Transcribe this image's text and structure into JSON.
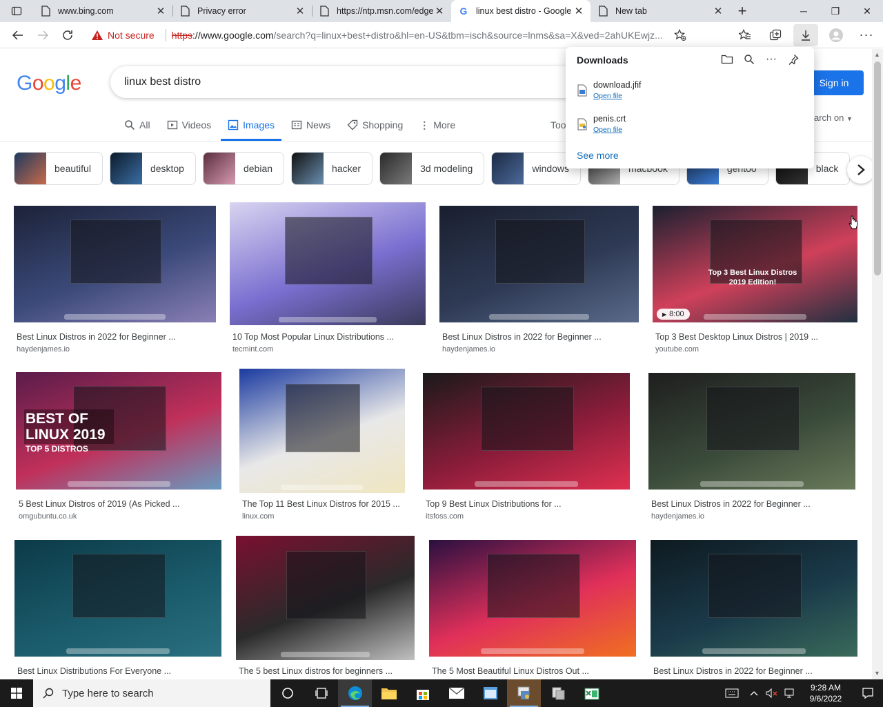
{
  "browser": {
    "tabs": [
      {
        "title": "www.bing.com",
        "icon": "page-icon"
      },
      {
        "title": "Privacy error",
        "icon": "page-icon"
      },
      {
        "title": "https://ntp.msn.com/edge",
        "icon": "page-icon"
      },
      {
        "title": "linux best distro - Google",
        "icon": "google-icon",
        "active": true
      },
      {
        "title": "New tab",
        "icon": "page-icon"
      }
    ],
    "security_label": "Not secure",
    "url": {
      "scheme": "https",
      "host": "://www.google.com",
      "path": "/search?q=linux+best+distro&hl=en-US&tbm=isch&source=lnms&sa=X&ved=2ahUKEwjz..."
    }
  },
  "google": {
    "logo": "Google",
    "query": "linux best distro",
    "sign_in": "Sign in",
    "search_on_partial": "arch on",
    "nav": [
      {
        "label": "All",
        "icon": "search-icon"
      },
      {
        "label": "Videos",
        "icon": "video-icon"
      },
      {
        "label": "Images",
        "icon": "image-icon",
        "active": true
      },
      {
        "label": "News",
        "icon": "news-icon"
      },
      {
        "label": "Shopping",
        "icon": "tag-icon"
      },
      {
        "label": "More",
        "icon": "more-vertical-icon"
      }
    ],
    "tools_partial": "Too",
    "chips": [
      {
        "label": "beautiful",
        "colors": [
          "#1e3a5f",
          "#c86a4a"
        ]
      },
      {
        "label": "desktop",
        "colors": [
          "#0d1b2a",
          "#3a6ea5"
        ]
      },
      {
        "label": "debian",
        "colors": [
          "#5a2e3e",
          "#d79ab0"
        ]
      },
      {
        "label": "hacker",
        "colors": [
          "#111",
          "#6a8fb0"
        ]
      },
      {
        "label": "3d modeling",
        "colors": [
          "#2a2a2a",
          "#7a7a7a"
        ]
      },
      {
        "label": "windows",
        "colors": [
          "#1c2a44",
          "#4c6a9a"
        ]
      },
      {
        "label": "macbook",
        "colors": [
          "#333",
          "#aaa"
        ]
      },
      {
        "label": "gentoo",
        "colors": [
          "#1d3557",
          "#3a7bd5"
        ]
      },
      {
        "label": "black",
        "colors": [
          "#0a0a0a",
          "#333"
        ]
      }
    ],
    "results": [
      {
        "caption": "Best Linux Distros in 2022 for Beginner ...",
        "source": "haydenjames.io",
        "colors": [
          "#1c2238",
          "#3b4a7a",
          "#8a7fb5"
        ]
      },
      {
        "caption": "10 Top Most Popular Linux Distributions ...",
        "source": "tecmint.com",
        "colors": [
          "#d8d4f0",
          "#7a6fd0",
          "#3a3a5a"
        ]
      },
      {
        "caption": "Best Linux Distros in 2022 for Beginner ...",
        "source": "haydenjames.io",
        "colors": [
          "#1a1f2e",
          "#2e3a55",
          "#5a6a8a"
        ]
      },
      {
        "caption": "Top 3 Best Desktop Linux Distros | 2019 ...",
        "source": "youtube.com",
        "colors": [
          "#1a2030",
          "#d0405a",
          "#203040"
        ],
        "overlay": "Top 3 Best Linux Distros 2019 Edition!",
        "duration": "8:00"
      },
      {
        "caption": "5 Best Linux Distros of 2019 (As Picked ...",
        "source": "omgubuntu.co.uk",
        "colors": [
          "#5a1c4a",
          "#c0305a",
          "#6a9ac0"
        ],
        "overlay": "BEST OF LINUX 2019",
        "overlay_sub": "TOP 5 DISTROS"
      },
      {
        "caption": "The Top 11 Best Linux Distros for 2015 ...",
        "source": "linux.com",
        "colors": [
          "#1a3aa0",
          "#e8e8e8",
          "#f0e6c0"
        ]
      },
      {
        "caption": "Top 9 Best Linux Distributions for ...",
        "source": "itsfoss.com",
        "colors": [
          "#1a1a1a",
          "#8a1c3a",
          "#e03050"
        ]
      },
      {
        "caption": "Best Linux Distros in 2022 for Beginner ...",
        "source": "haydenjames.io",
        "colors": [
          "#1e1e1e",
          "#3a4a3a",
          "#6a7a5a"
        ]
      },
      {
        "caption": "Best Linux Distributions For Everyone ...",
        "source": "",
        "colors": [
          "#0c3a48",
          "#1a5a6a",
          "#2a7080"
        ]
      },
      {
        "caption": "The 5 best Linux distros for beginners ...",
        "source": "",
        "colors": [
          "#7a1030",
          "#2a2a2a",
          "#c0c0c0"
        ]
      },
      {
        "caption": "The 5 Most Beautiful Linux Distros Out ...",
        "source": "",
        "colors": [
          "#2a1040",
          "#e0305a",
          "#f07020"
        ]
      },
      {
        "caption": "Best Linux Distros in 2022 for Beginner ...",
        "source": "",
        "colors": [
          "#0e1a20",
          "#1a3a4a",
          "#3a6a5a"
        ]
      }
    ]
  },
  "downloads": {
    "title": "Downloads",
    "items": [
      {
        "name": "download.jfif",
        "action": "Open file"
      },
      {
        "name": "penis.crt",
        "action": "Open file"
      }
    ],
    "see_more": "See more"
  },
  "taskbar": {
    "search_placeholder": "Type here to search",
    "time": "9:28 AM",
    "date": "9/6/2022"
  }
}
